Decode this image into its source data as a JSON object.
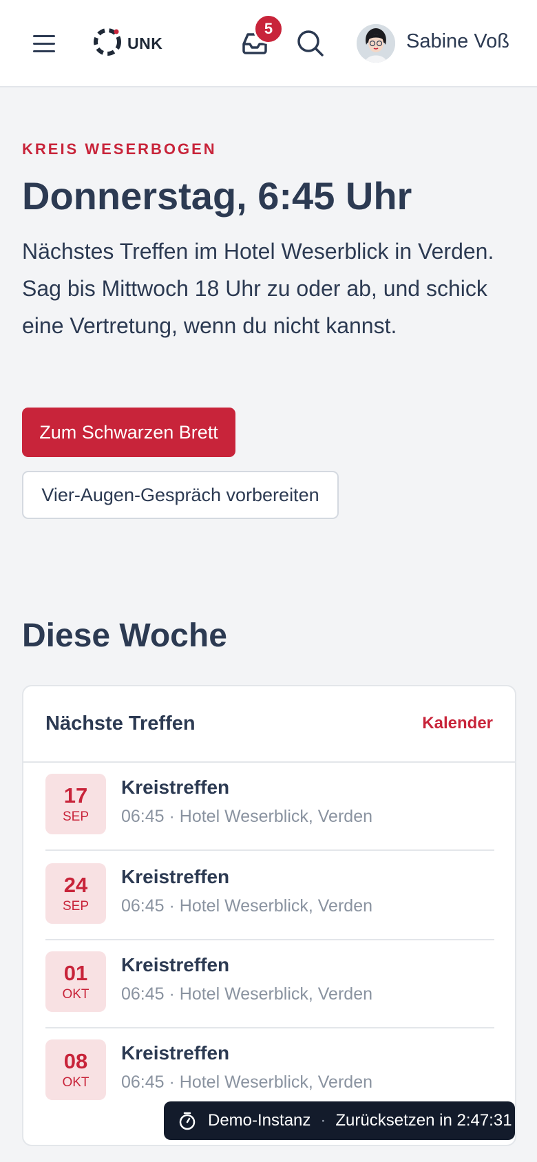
{
  "header": {
    "logo_text": "UNK",
    "notification_count": "5",
    "user_name": "Sabine Voß"
  },
  "hero": {
    "eyebrow": "KREIS WESERBOGEN",
    "title": "Donnerstag, 6:45 Uhr",
    "text": "Nächstes Treffen im Hotel Weserblick in Verden. Sag bis Mittwoch 18 Uhr zu oder ab, und schick eine Vertretung, wenn du nicht kannst.",
    "primary_button": "Zum Schwarzen Brett",
    "secondary_button": "Vier-Augen-Gespräch vorbereiten"
  },
  "week": {
    "section_title": "Diese Woche",
    "card_title": "Nächste Treffen",
    "card_link": "Kalender",
    "events": [
      {
        "day": "17",
        "month": "SEP",
        "title": "Kreistreffen",
        "meta": "06:45 · Hotel Weserblick, Verden"
      },
      {
        "day": "24",
        "month": "SEP",
        "title": "Kreistreffen",
        "meta": "06:45 · Hotel Weserblick, Verden"
      },
      {
        "day": "01",
        "month": "OKT",
        "title": "Kreistreffen",
        "meta": "06:45 · Hotel Weserblick, Verden"
      },
      {
        "day": "08",
        "month": "OKT",
        "title": "Kreistreffen",
        "meta": "06:45 · Hotel Weserblick, Verden"
      }
    ]
  },
  "toast": {
    "label": "Demo-Instanz",
    "separator": "·",
    "reset_text": "Zurücksetzen in 2:47:31"
  },
  "colors": {
    "accent": "#c8243a",
    "text": "#2c3a52",
    "muted": "#8a93a0",
    "background": "#f3f4f6"
  },
  "icons": [
    "menu-icon",
    "logo-ring-icon",
    "inbox-icon",
    "search-icon",
    "avatar-image",
    "timer-icon"
  ]
}
